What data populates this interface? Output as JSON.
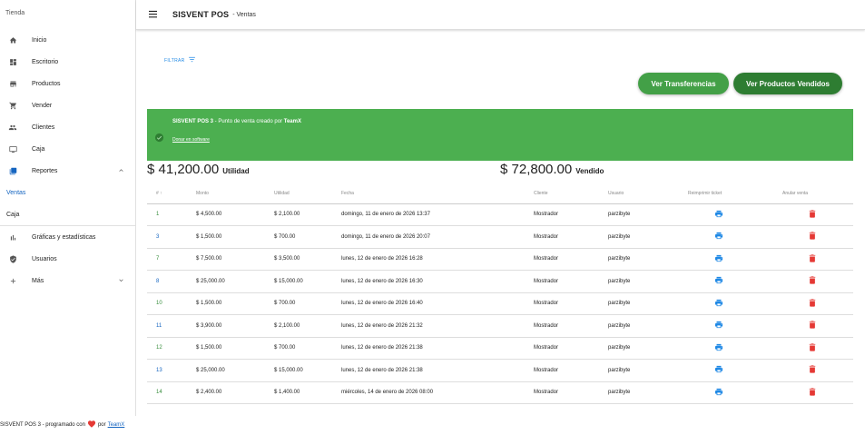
{
  "sidebar": {
    "brand": "Tienda",
    "items": [
      {
        "label": "Inicio",
        "icon": "home-icon"
      },
      {
        "label": "Escritorio",
        "icon": "dashboard-icon"
      },
      {
        "label": "Productos",
        "icon": "store-icon"
      },
      {
        "label": "Vender",
        "icon": "cart-icon"
      },
      {
        "label": "Clientes",
        "icon": "people-icon"
      },
      {
        "label": "Caja",
        "icon": "monitor-icon"
      },
      {
        "label": "Reportes",
        "icon": "library-icon"
      }
    ],
    "sub_items": [
      {
        "label": "Ventas",
        "active": true
      },
      {
        "label": "Caja",
        "active": false
      }
    ],
    "items2": [
      {
        "label": "Gráficas y estadísticas",
        "icon": "bar-chart-icon"
      },
      {
        "label": "Usuarios",
        "icon": "shield-icon"
      },
      {
        "label": "Más",
        "icon": "plus-icon"
      }
    ]
  },
  "topbar": {
    "title": "SISVENT POS",
    "subtitle": "- Ventas"
  },
  "main": {
    "filter_label": "FILTRAR",
    "btn_transfers": "Ver Transferencias",
    "btn_sold": "Ver Productos Vendidos",
    "alert": {
      "title_bold": "SISVENT POS 3",
      "title_rest": " - Punto de venta creado por ",
      "title_author": "TeamX",
      "link": "Donar en software"
    },
    "summary": {
      "utilidad_amount": "$ 41,200.00",
      "utilidad_label": "Utilidad",
      "vendido_amount": "$ 72,800.00",
      "vendido_label": "Vendido"
    },
    "table": {
      "headers": [
        "#",
        "Monto",
        "Utilidad",
        "Fecha",
        "Cliente",
        "Usuario",
        "Reimprimir ticket",
        "Anular venta"
      ],
      "rows": [
        {
          "id": "1",
          "monto": "$ 4,500.00",
          "utilidad": "$ 2,100.00",
          "fecha": "domingo, 11 de enero de 2026 13:37",
          "cliente": "Mostrador",
          "usuario": "parzibyte"
        },
        {
          "id": "3",
          "monto": "$ 1,500.00",
          "utilidad": "$ 700.00",
          "fecha": "domingo, 11 de enero de 2026 20:07",
          "cliente": "Mostrador",
          "usuario": "parzibyte"
        },
        {
          "id": "7",
          "monto": "$ 7,500.00",
          "utilidad": "$ 3,500.00",
          "fecha": "lunes, 12 de enero de 2026 16:28",
          "cliente": "Mostrador",
          "usuario": "parzibyte"
        },
        {
          "id": "8",
          "monto": "$ 25,000.00",
          "utilidad": "$ 15,000.00",
          "fecha": "lunes, 12 de enero de 2026 16:30",
          "cliente": "Mostrador",
          "usuario": "parzibyte"
        },
        {
          "id": "10",
          "monto": "$ 1,500.00",
          "utilidad": "$ 700.00",
          "fecha": "lunes, 12 de enero de 2026 16:40",
          "cliente": "Mostrador",
          "usuario": "parzibyte"
        },
        {
          "id": "11",
          "monto": "$ 3,900.00",
          "utilidad": "$ 2,100.00",
          "fecha": "lunes, 12 de enero de 2026 21:32",
          "cliente": "Mostrador",
          "usuario": "parzibyte"
        },
        {
          "id": "12",
          "monto": "$ 1,500.00",
          "utilidad": "$ 700.00",
          "fecha": "lunes, 12 de enero de 2026 21:38",
          "cliente": "Mostrador",
          "usuario": "parzibyte"
        },
        {
          "id": "13",
          "monto": "$ 25,000.00",
          "utilidad": "$ 15,000.00",
          "fecha": "lunes, 12 de enero de 2026 21:38",
          "cliente": "Mostrador",
          "usuario": "parzibyte"
        },
        {
          "id": "14",
          "monto": "$ 2,400.00",
          "utilidad": "$ 1,400.00",
          "fecha": "miércoles, 14 de enero de 2026 08:00",
          "cliente": "Mostrador",
          "usuario": "parzibyte"
        }
      ]
    }
  },
  "footer": {
    "text": "SISVENT POS 3 - programado con",
    "by": "por",
    "link": "TeamX"
  },
  "colors": {
    "accent": "#4caf50",
    "accent_dark": "#2e7d32",
    "print": "#1e88e5",
    "delete": "#e53935",
    "link": "#1565c0"
  }
}
